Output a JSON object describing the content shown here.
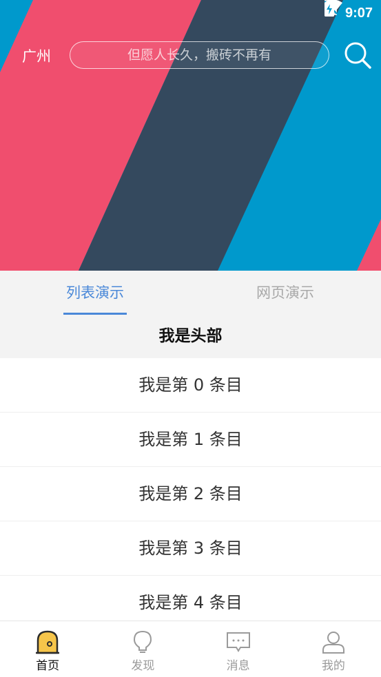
{
  "status_bar": {
    "time": "9:07"
  },
  "header": {
    "city": "广州",
    "search_placeholder": "但愿人长久，搬砖不再有",
    "banner_colors": [
      "#0099cc",
      "#f04e6e",
      "#34495e"
    ]
  },
  "tabs": [
    {
      "label": "列表演示",
      "active": true
    },
    {
      "label": "网页演示",
      "active": false
    }
  ],
  "list": {
    "header": "我是头部",
    "items": [
      "我是第 0 条目",
      "我是第 1 条目",
      "我是第 2 条目",
      "我是第 3 条目",
      "我是第 4 条目"
    ]
  },
  "bottom_nav": [
    {
      "label": "首页",
      "icon": "home-icon",
      "active": true
    },
    {
      "label": "发现",
      "icon": "lightbulb-icon",
      "active": false
    },
    {
      "label": "消息",
      "icon": "message-icon",
      "active": false
    },
    {
      "label": "我的",
      "icon": "profile-icon",
      "active": false
    }
  ],
  "colors": {
    "accent": "#4a88d8",
    "inactive": "#9a9a9a",
    "home_icon_fill": "#f6c54a"
  }
}
